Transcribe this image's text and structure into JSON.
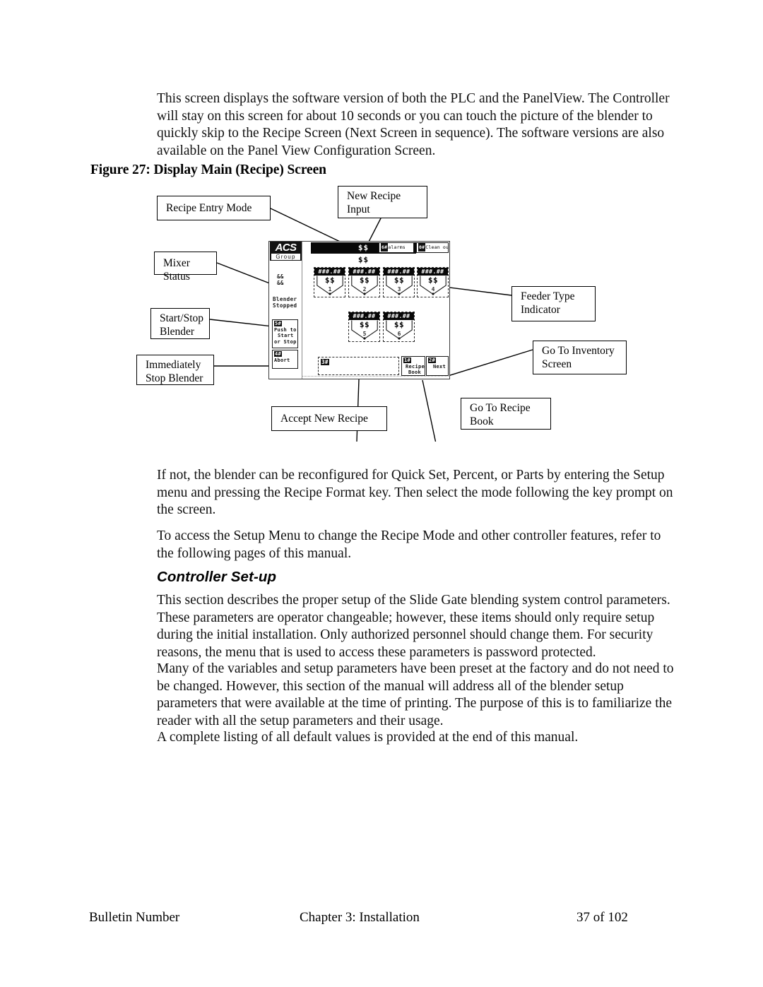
{
  "document": {
    "paragraphs": [
      "This screen displays the software version of both the PLC and the PanelView.  The Controller will stay on this screen for about 10 seconds or you can touch the picture of the blender to quickly skip to the Recipe Screen (Next Screen in sequence).  The software versions are also available on the Panel View Configuration Screen.",
      "If not, the blender can be reconfigured for Quick Set, Percent, or Parts by entering the Setup menu and pressing the Recipe Format key. Then select the mode following the key prompt on the screen.",
      "To access the Setup Menu to change the Recipe Mode and other controller features, refer to the following pages of this manual.",
      "This section describes the proper setup of the Slide Gate blending system control parameters. These parameters are operator changeable; however, these items should only require setup during the initial installation. Only authorized personnel should change them. For security reasons, the menu that is used to access these parameters is password protected.",
      "Many of the variables and setup parameters have been preset at the factory and do not need to be changed. However, this section of the manual will address all of the blender setup parameters that were available at the time of printing. The purpose of this is to familiarize the reader with all the setup parameters and their usage.",
      "A complete listing of all default values is provided at the end of this manual."
    ],
    "figure_caption": "Figure 27: Display Main (Recipe) Screen",
    "section_heading": "Controller Set-up"
  },
  "footer": {
    "left": "Bulletin Number",
    "center": "Chapter 3: Installation",
    "right": "37 of 102"
  },
  "callouts": [
    {
      "id": "recipe-entry-mode",
      "label": "Recipe Entry Mode"
    },
    {
      "id": "new-recipe-input",
      "label": "New Recipe\nInput"
    },
    {
      "id": "mixer-status",
      "label": "Mixer Status"
    },
    {
      "id": "feeder-type",
      "label": "Feeder Type\nIndicator"
    },
    {
      "id": "start-stop-blender",
      "label": "Start/Stop\nBlender"
    },
    {
      "id": "inventory-screen",
      "label": "Go To Inventory\nScreen"
    },
    {
      "id": "immediately-stop",
      "label": "Immediately\nStop Blender"
    },
    {
      "id": "accept-new-recipe",
      "label": "Accept New Recipe"
    },
    {
      "id": "recipe-book",
      "label": "Go To Recipe\nBook"
    }
  ],
  "panelview": {
    "logo_line1": "ACS",
    "logo_line2": "Group",
    "recipe_banner": "$$",
    "recipe_sub": "$$",
    "top_buttons": [
      {
        "key": "6#",
        "label": "alarms"
      },
      {
        "key": "0#",
        "label": "Clean out"
      }
    ],
    "mixer_status_line1": "&&",
    "mixer_status_line2": "&&",
    "blender_status_line1": "Blender",
    "blender_status_line2": "Stopped",
    "start_stop_button": {
      "key": "5#",
      "line1": "Push to",
      "line2": "Start",
      "line3": "or Stop"
    },
    "abort_button": {
      "key": "4#",
      "line1": "Abort"
    },
    "hoppers": [
      {
        "header": "###.##",
        "value": "$$",
        "number": "1"
      },
      {
        "header": "###.##",
        "value": "$$",
        "number": "2"
      },
      {
        "header": "###.##",
        "value": "$$",
        "number": "3"
      },
      {
        "header": "###.##",
        "value": "$$",
        "number": "4"
      },
      {
        "header": "###.##",
        "value": "$$",
        "number": "5"
      },
      {
        "header": "###.##",
        "value": "$$",
        "number": "6"
      }
    ],
    "message_box_key": "3#",
    "recipe_book_button": {
      "key": "1#",
      "line1": "Recipe",
      "line2": "Book"
    },
    "next_button": {
      "key": "2#",
      "line1": "Next"
    }
  },
  "colors": {
    "ink": "#000000",
    "paper": "#ffffff",
    "panel_dark": "#080808",
    "panel_border": "#1a1a1a"
  }
}
